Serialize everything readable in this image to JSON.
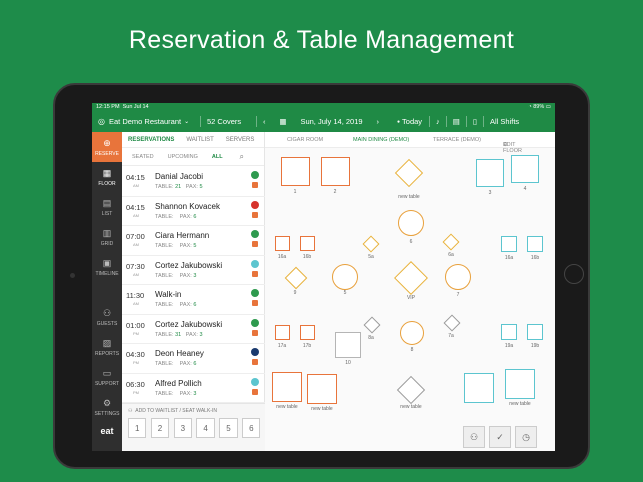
{
  "headline": "Reservation & Table Management",
  "status": {
    "time": "12:15 PM",
    "date": "Sun Jul 14",
    "battery": "89%"
  },
  "topbar": {
    "restaurant": "Eat Demo Restaurant",
    "covers": "52 Covers",
    "date": "Sun, July 14, 2019",
    "today": "Today",
    "shifts": "All Shifts"
  },
  "sidebar": [
    {
      "label": "RESERVE",
      "icon": "⊕"
    },
    {
      "label": "FLOOR",
      "icon": "▦"
    },
    {
      "label": "LIST",
      "icon": "▤"
    },
    {
      "label": "GRID",
      "icon": "▥"
    },
    {
      "label": "TIMELINE",
      "icon": "▣"
    },
    {
      "label": "GUESTS",
      "icon": "⚇"
    },
    {
      "label": "REPORTS",
      "icon": "▨"
    },
    {
      "label": "SUPPORT",
      "icon": "▭"
    },
    {
      "label": "SETTINGS",
      "icon": "⚙"
    }
  ],
  "brand": "eat",
  "listtabs": {
    "reservations": "RESERVATIONS",
    "waitlist": "WAITLIST",
    "servers": "SERVERS"
  },
  "subtabs": {
    "seated": "SEATED",
    "upcoming": "UPCOMING",
    "all": "ALL"
  },
  "rows": [
    {
      "time": "04:15",
      "ampm": "AM",
      "name": "Danial Jacobi",
      "table": "21",
      "pax": "5",
      "status_color": "#2e9a4e"
    },
    {
      "time": "04:15",
      "ampm": "AM",
      "name": "Shannon Kovacek",
      "table": "",
      "pax": "6",
      "status_color": "#d6332c"
    },
    {
      "time": "07:00",
      "ampm": "AM",
      "name": "Ciara Hermann",
      "table": "",
      "pax": "5",
      "status_color": "#2e9a4e"
    },
    {
      "time": "07:30",
      "ampm": "AM",
      "name": "Cortez Jakubowski",
      "table": "",
      "pax": "3",
      "status_color": "#5cc5cf"
    },
    {
      "time": "11:30",
      "ampm": "AM",
      "name": "Walk-in",
      "table": "",
      "pax": "6",
      "status_color": "#2e9a4e"
    },
    {
      "time": "01:00",
      "ampm": "PM",
      "name": "Cortez Jakubowski",
      "table": "31",
      "pax": "3",
      "status_color": "#2e9a4e"
    },
    {
      "time": "04:30",
      "ampm": "PM",
      "name": "Deon Heaney",
      "table": "",
      "pax": "6",
      "status_color": "#1a3a6e"
    },
    {
      "time": "06:30",
      "ampm": "PM",
      "name": "Alfred Pollich",
      "table": "",
      "pax": "3",
      "status_color": "#5cc5cf"
    }
  ],
  "labels": {
    "table": "TABLE:",
    "pax": "PAX:"
  },
  "walkin": {
    "label": "ADD TO WAITLIST / SEAT WALK-IN",
    "nums": [
      "1",
      "2",
      "3",
      "4",
      "5",
      "6"
    ]
  },
  "floortabs": {
    "cigar": "CIGAR ROOM",
    "main": "MAIN DINING (DEMO)",
    "terrace": "TERRACE (DEMO)",
    "edit": "EDIT FLOOR"
  },
  "tables": {
    "t1": "1",
    "t2": "2",
    "t3": "3",
    "t4": "4",
    "newtable": "new table",
    "t16a": "16a",
    "t16b": "16b",
    "t5a": "5a",
    "t6": "6",
    "t6a": "6a",
    "t16a2": "16a",
    "t16b2": "16b",
    "t9": "9",
    "t5": "5",
    "tvip": "VIP",
    "t7": "7",
    "t17a": "17a",
    "t17b": "17b",
    "t8a": "8a",
    "t8": "8",
    "t7a": "7a",
    "t19a": "19a",
    "t19b": "19b",
    "t10": "10"
  }
}
